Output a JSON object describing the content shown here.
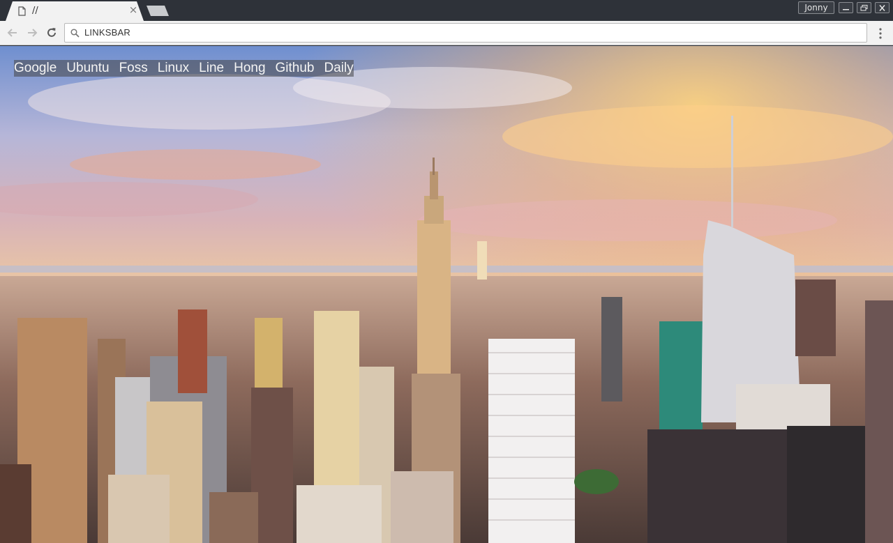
{
  "window": {
    "tab_title": "//",
    "tab_close": "×",
    "user_name": "Jonny"
  },
  "toolbar": {
    "address": "LINKSBAR"
  },
  "linksbar": {
    "links": [
      "Google",
      "Ubuntu",
      "Foss",
      "Linux",
      "Line",
      "Hong",
      "Github",
      "Daily"
    ]
  },
  "icons": {
    "tab": "page-icon",
    "back": "back-arrow-icon",
    "forward": "forward-arrow-icon",
    "reload": "reload-icon",
    "search": "search-icon",
    "menu": "menu-dots-icon"
  },
  "colors": {
    "frame": "#2e3239",
    "toolbar": "#f2f2f2",
    "linksbar_bg": "#464646",
    "link_text": "#f4f4f4"
  }
}
